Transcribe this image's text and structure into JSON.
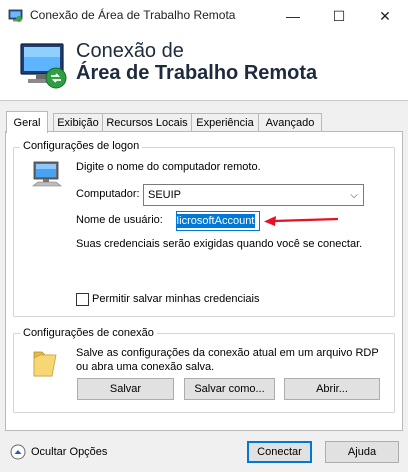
{
  "window": {
    "title": "Conexão de Área de Trabalho Remota"
  },
  "titlebar": {
    "minimize": "—",
    "maximize": "☐",
    "close": "✕"
  },
  "banner": {
    "line1": "Conexão de",
    "line2": "Área de Trabalho Remota"
  },
  "tabs": [
    {
      "label": "Geral",
      "active": true
    },
    {
      "label": "Exibição"
    },
    {
      "label": "Recursos Locais"
    },
    {
      "label": "Experiência"
    },
    {
      "label": "Avançado"
    }
  ],
  "logon": {
    "group_label": "Configurações de logon",
    "instruction": "Digite o nome do computador remoto.",
    "computer_label": "Computador:",
    "computer_value": "SEUIP",
    "username_label": "Nome de usuário:",
    "username_value": "MicrosoftAccount",
    "credentials_note": "Suas credenciais serão exigidas quando você se conectar.",
    "save_credentials_label": "Permitir salvar minhas credenciais"
  },
  "connection": {
    "group_label": "Configurações de conexão",
    "description_line1": "Salve as configurações da conexão atual em um arquivo RDP",
    "description_line2": "ou abra uma conexão salva.",
    "save_label": "Salvar",
    "save_as_label": "Salvar como...",
    "open_label": "Abrir..."
  },
  "footer": {
    "hide_options_label": "Ocultar Opções",
    "connect_label": "Conectar",
    "help_label": "Ajuda"
  },
  "colors": {
    "accent": "#0078d7",
    "arrow": "#e81123"
  }
}
